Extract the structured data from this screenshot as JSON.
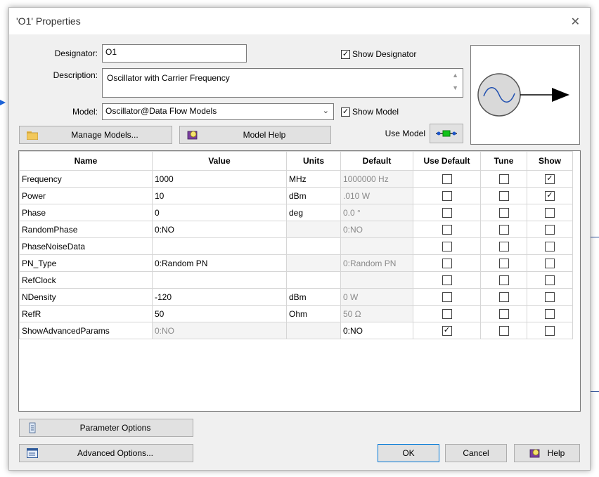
{
  "dialog": {
    "title": "'O1' Properties",
    "close_glyph": "✕"
  },
  "designator": {
    "label": "Designator:",
    "value": "O1"
  },
  "show_designator": {
    "label": "Show Designator",
    "checked": true
  },
  "description": {
    "label": "Description:",
    "value": "Oscillator with Carrier Frequency"
  },
  "model": {
    "label": "Model:",
    "value": "Oscillator@Data Flow Models"
  },
  "show_model": {
    "label": "Show Model",
    "checked": true
  },
  "use_model": {
    "label": "Use Model"
  },
  "buttons": {
    "manage_models": "Manage Models...",
    "model_help": "Model Help",
    "parameter_options": "Parameter Options",
    "advanced_options": "Advanced Options...",
    "ok": "OK",
    "cancel": "Cancel",
    "help": "Help"
  },
  "table": {
    "columns": [
      "Name",
      "Value",
      "Units",
      "Default",
      "Use Default",
      "Tune",
      "Show"
    ],
    "rows": [
      {
        "name": "Frequency",
        "value": "1000",
        "units": "MHz",
        "default": "1000000 Hz",
        "use_default": false,
        "tune": false,
        "show": true,
        "value_grey": false,
        "default_grey": true
      },
      {
        "name": "Power",
        "value": "10",
        "units": "dBm",
        "default": ".010 W",
        "use_default": false,
        "tune": false,
        "show": true,
        "value_grey": false,
        "default_grey": true
      },
      {
        "name": "Phase",
        "value": "0",
        "units": "deg",
        "default": "0.0 °",
        "use_default": false,
        "tune": false,
        "show": false,
        "value_grey": false,
        "default_grey": true
      },
      {
        "name": "RandomPhase",
        "value": "0:NO",
        "units": "",
        "default": "0:NO",
        "use_default": false,
        "tune": false,
        "show": false,
        "value_grey": false,
        "default_grey": true
      },
      {
        "name": "PhaseNoiseData",
        "value": "",
        "units": "",
        "default": "",
        "use_default": false,
        "tune": false,
        "show": false,
        "value_grey": false,
        "default_grey": true
      },
      {
        "name": "PN_Type",
        "value": "0:Random PN",
        "units": "",
        "default": "0:Random PN",
        "use_default": false,
        "tune": false,
        "show": false,
        "value_grey": false,
        "default_grey": true
      },
      {
        "name": "RefClock",
        "value": "",
        "units": "",
        "default": "",
        "use_default": false,
        "tune": false,
        "show": false,
        "value_grey": false,
        "default_grey": true
      },
      {
        "name": "NDensity",
        "value": "-120",
        "units": "dBm",
        "default": "0 W",
        "use_default": false,
        "tune": false,
        "show": false,
        "value_grey": false,
        "default_grey": true
      },
      {
        "name": "RefR",
        "value": "50",
        "units": "Ohm",
        "default": "50 Ω",
        "use_default": false,
        "tune": false,
        "show": false,
        "value_grey": false,
        "default_grey": true
      },
      {
        "name": "ShowAdvancedParams",
        "value": "0:NO",
        "units": "",
        "default": "0:NO",
        "use_default": true,
        "tune": false,
        "show": false,
        "value_grey": true,
        "default_grey": false
      }
    ]
  }
}
